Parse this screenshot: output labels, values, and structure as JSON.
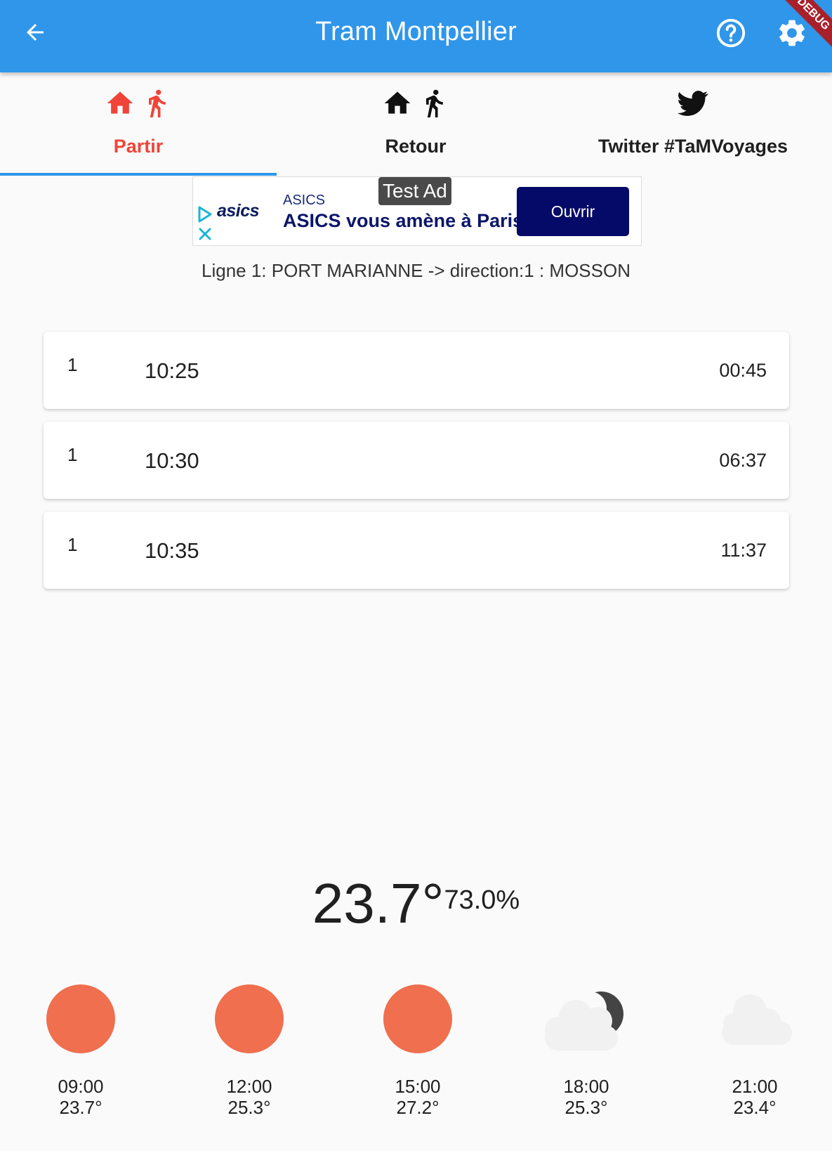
{
  "appbar": {
    "title": "Tram Montpellier",
    "debug_label": "DEBUG",
    "icons": [
      "back-arrow-icon",
      "help-circle-icon",
      "gear-icon"
    ]
  },
  "tabs": [
    {
      "label": "Partir",
      "icons": [
        "home-icon",
        "walk-icon"
      ],
      "active": true
    },
    {
      "label": "Retour",
      "icons": [
        "home-icon",
        "walk-icon"
      ],
      "active": false
    },
    {
      "label": "Twitter #TaMVoyages",
      "icons": [
        "twitter-icon"
      ],
      "active": false
    }
  ],
  "ad": {
    "badge": "Test Ad",
    "brand_logo": "asics",
    "advertiser": "ASICS",
    "headline": "ASICS vous amène à Paris",
    "cta": "Ouvrir"
  },
  "line_info": "Ligne 1: PORT MARIANNE -> direction:1 : MOSSON",
  "departures": [
    {
      "line": "1",
      "time": "10:25",
      "wait": "00:45"
    },
    {
      "line": "1",
      "time": "10:30",
      "wait": "06:37"
    },
    {
      "line": "1",
      "time": "10:35",
      "wait": "11:37"
    }
  ],
  "weather": {
    "current_temp": "23.7°",
    "humidity": "73.0%",
    "forecast": [
      {
        "time": "09:00",
        "temp": "23.7°",
        "icon": "sun-icon"
      },
      {
        "time": "12:00",
        "temp": "25.3°",
        "icon": "sun-icon"
      },
      {
        "time": "15:00",
        "temp": "27.2°",
        "icon": "sun-icon"
      },
      {
        "time": "18:00",
        "temp": "25.3°",
        "icon": "cloud-moon-icon"
      },
      {
        "time": "21:00",
        "temp": "23.4°",
        "icon": "cloud-icon"
      }
    ]
  },
  "colors": {
    "appbar": "#2f96ea",
    "active_tab": "#f04438",
    "sun": "#ef6f4e",
    "ad_cta": "#050968"
  }
}
